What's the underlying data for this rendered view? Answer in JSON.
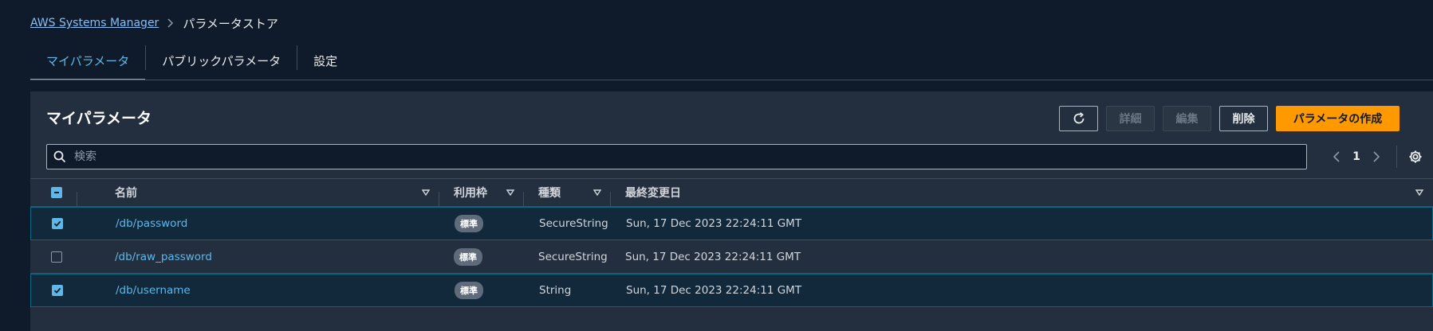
{
  "breadcrumb": {
    "root": "AWS Systems Manager",
    "current": "パラメータストア"
  },
  "tabs": [
    {
      "label": "マイパラメータ",
      "active": true
    },
    {
      "label": "パブリックパラメータ",
      "active": false
    },
    {
      "label": "設定",
      "active": false
    }
  ],
  "panel": {
    "title": "マイパラメータ",
    "buttons": {
      "details": "詳細",
      "edit": "編集",
      "delete": "削除",
      "create": "パラメータの作成"
    },
    "search": {
      "placeholder": "検索",
      "value": ""
    },
    "pagination": {
      "current_page": "1"
    }
  },
  "table": {
    "headers": {
      "name": "名前",
      "tier": "利用枠",
      "type": "種類",
      "last_modified": "最終変更日"
    },
    "rows": [
      {
        "name": "/db/password",
        "tier": "標準",
        "type": "SecureString",
        "last_modified": "Sun, 17 Dec 2023 22:24:11 GMT",
        "selected": true
      },
      {
        "name": "/db/raw_password",
        "tier": "標準",
        "type": "SecureString",
        "last_modified": "Sun, 17 Dec 2023 22:24:11 GMT",
        "selected": false
      },
      {
        "name": "/db/username",
        "tier": "標準",
        "type": "String",
        "last_modified": "Sun, 17 Dec 2023 22:24:11 GMT",
        "selected": true
      }
    ]
  },
  "icons": {
    "chevron_right": "chevron-right-icon",
    "refresh": "refresh-icon",
    "search": "search-icon",
    "prev": "chevron-left-icon",
    "next": "chevron-right-icon",
    "settings": "gear-icon",
    "sort": "caret-down-icon",
    "check": "check-icon"
  },
  "colors": {
    "background": "#0f1b2a",
    "panel": "#232f3e",
    "accent": "#5fb7e8",
    "primary_button": "#ff9900",
    "selected_row": "#12293b"
  }
}
